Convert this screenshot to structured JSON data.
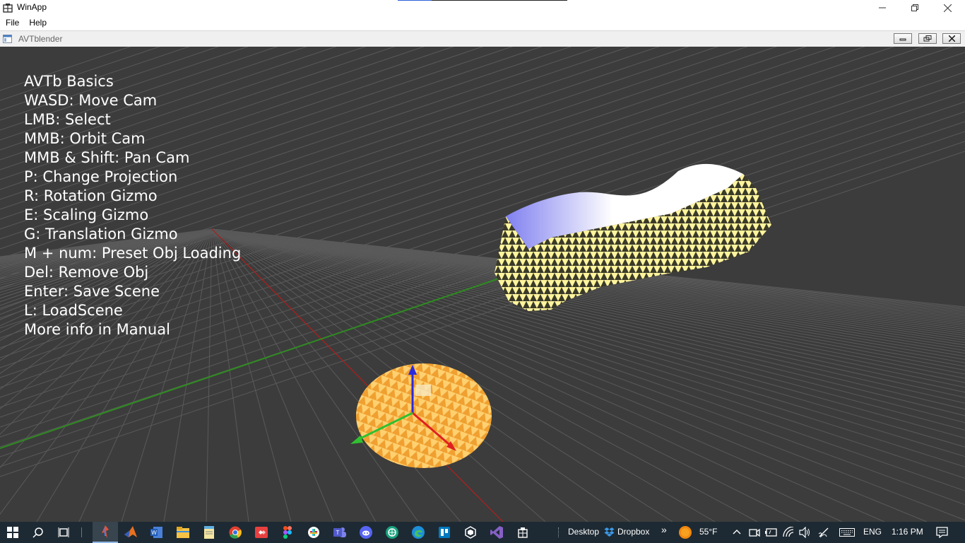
{
  "window": {
    "title": "WinApp",
    "minimize_icon": "minimize-icon",
    "restore_icon": "restore-icon",
    "close_icon": "close-icon",
    "load_progress": 0.2
  },
  "menu": {
    "items": [
      {
        "label": "File"
      },
      {
        "label": "Help"
      }
    ]
  },
  "child_window": {
    "title": "AVTblender"
  },
  "viewport": {
    "background_color": "#3c3c3c",
    "grid_color": "#5a5a5a",
    "x_axis_color": "#b01c1c",
    "z_axis_color": "#2e8b20",
    "help_lines": [
      "AVTb Basics",
      "WASD: Move Cam",
      "LMB: Select",
      "MMB: Orbit Cam",
      "MMB & Shift: Pan Cam",
      "P: Change Projection",
      "R: Rotation Gizmo",
      "E: Scaling Gizmo",
      "G: Translation Gizmo",
      "M + num: Preset Obj Loading",
      "Del: Remove Obj",
      "Enter: Save Scene",
      "L: LoadScene",
      "More info in Manual"
    ]
  },
  "taskbar": {
    "pinned_icons": [
      "start-icon",
      "search-icon",
      "task-view-icon",
      "avtblender-app-icon",
      "matlab-icon",
      "word-icon",
      "file-explorer-icon",
      "notepad-icon",
      "chrome-icon",
      "anydesk-icon",
      "figma-icon",
      "slack-icon",
      "teams-icon",
      "discord-icon",
      "chatgpt-icon",
      "edge-icon",
      "trello-icon",
      "unity-icon",
      "visual-studio-icon",
      "winapp-icon"
    ],
    "desktop_label": "Desktop",
    "dropbox_label": "Dropbox",
    "overflow_label": "»",
    "temperature": "55°F",
    "language": "ENG",
    "time": "1:16 PM"
  }
}
